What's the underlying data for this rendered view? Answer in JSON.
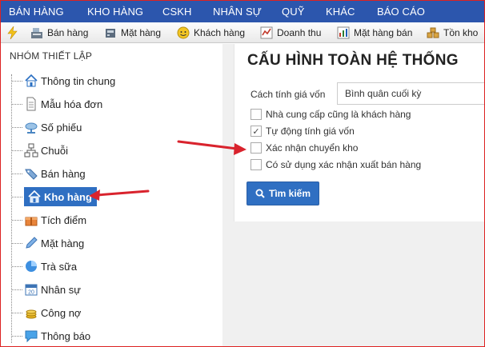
{
  "topnav": {
    "items": [
      {
        "label": "BÁN HÀNG"
      },
      {
        "label": "KHO HÀNG"
      },
      {
        "label": "CSKH"
      },
      {
        "label": "NHÂN SỰ"
      },
      {
        "label": "QUỸ"
      },
      {
        "label": "KHÁC"
      },
      {
        "label": "BÁO CÁO"
      }
    ]
  },
  "toolbar": {
    "items": [
      {
        "label": "Bán hàng",
        "icon": "register-icon"
      },
      {
        "label": "Mặt hàng",
        "icon": "product-icon"
      },
      {
        "label": "Khách hàng",
        "icon": "customer-icon"
      },
      {
        "label": "Doanh thu",
        "icon": "revenue-icon"
      },
      {
        "label": "Mặt hàng bán",
        "icon": "sold-items-icon"
      },
      {
        "label": "Tồn kho",
        "icon": "inventory-icon"
      }
    ]
  },
  "sidebar": {
    "title": "NHÓM THIẾT LẬP",
    "items": [
      {
        "label": "Thông tin chung",
        "icon": "home-icon"
      },
      {
        "label": "Mẫu hóa đơn",
        "icon": "document-icon"
      },
      {
        "label": "Số phiếu",
        "icon": "cloud-icon"
      },
      {
        "label": "Chuỗi",
        "icon": "network-icon"
      },
      {
        "label": "Bán hàng",
        "icon": "tag-icon"
      },
      {
        "label": "Kho hàng",
        "icon": "warehouse-icon",
        "active": true
      },
      {
        "label": "Tích điểm",
        "icon": "points-icon"
      },
      {
        "label": "Mặt hàng",
        "icon": "pencil-icon"
      },
      {
        "label": "Trà sữa",
        "icon": "pie-icon"
      },
      {
        "label": "Nhân sự",
        "icon": "calendar-icon"
      },
      {
        "label": "Công nợ",
        "icon": "coins-icon"
      },
      {
        "label": "Thông báo",
        "icon": "chat-icon"
      }
    ]
  },
  "main": {
    "title": "CẤU HÌNH TOÀN HỆ THỐNG",
    "cost_method_label": "Cách tính giá vốn",
    "cost_method_value": "Bình quân cuối kỳ",
    "options": [
      {
        "label": "Nhà cung cấp cũng là khách hàng",
        "checked": false
      },
      {
        "label": "Tự động tính giá vốn",
        "checked": true
      },
      {
        "label": "Xác nhận chuyển kho",
        "checked": false
      },
      {
        "label": "Có sử dụng xác nhận xuất bán hàng",
        "checked": false
      }
    ],
    "search_label": "Tìm kiếm"
  },
  "colors": {
    "nav_bg": "#2c56ad",
    "accent": "#2f6fc2",
    "arrow": "#d9232d"
  }
}
